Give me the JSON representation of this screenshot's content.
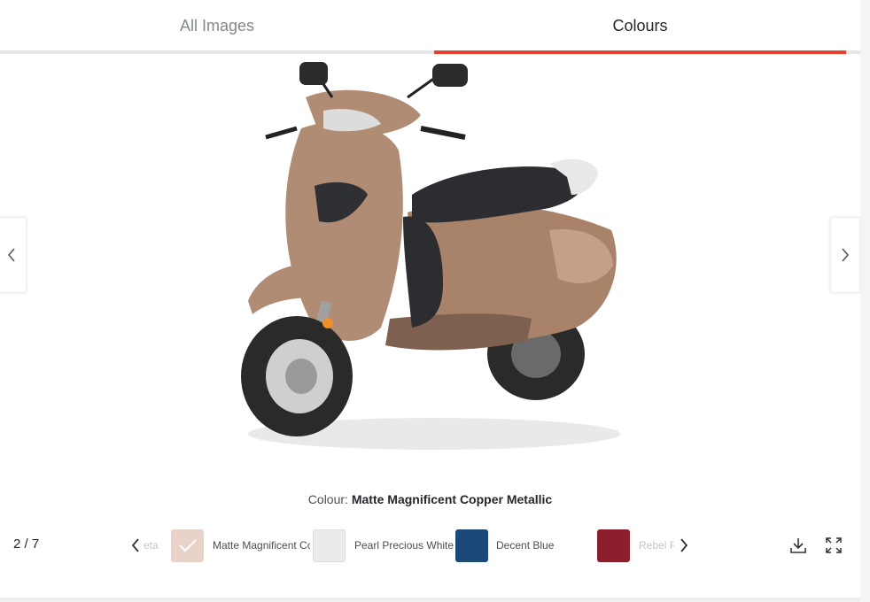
{
  "tabs": [
    {
      "label": "All Images",
      "active": false
    },
    {
      "label": "Colours",
      "active": true
    }
  ],
  "accent_color": "#e5412f",
  "caption": {
    "prefix": "Colour:",
    "colour_name": "Matte Magnificent Copper Metallic"
  },
  "counter": "2 / 7",
  "swatches": [
    {
      "label": "Meta",
      "color": "#ffffff",
      "selected": false
    },
    {
      "label": "Matte Magnificent Co",
      "color": "#e9d2c8",
      "selected": true
    },
    {
      "label": "Pearl Precious White",
      "color": "#ebebeb",
      "selected": false
    },
    {
      "label": "Decent Blue",
      "color": "#1b4a78",
      "selected": false
    },
    {
      "label": "Rebel R",
      "color": "#8c1f2c",
      "selected": false
    }
  ],
  "icons": {
    "prev_image": "chevron-left-icon",
    "next_image": "chevron-right-icon",
    "download": "download-icon",
    "fullscreen": "fullscreen-icon",
    "selected_check": "check-icon"
  }
}
